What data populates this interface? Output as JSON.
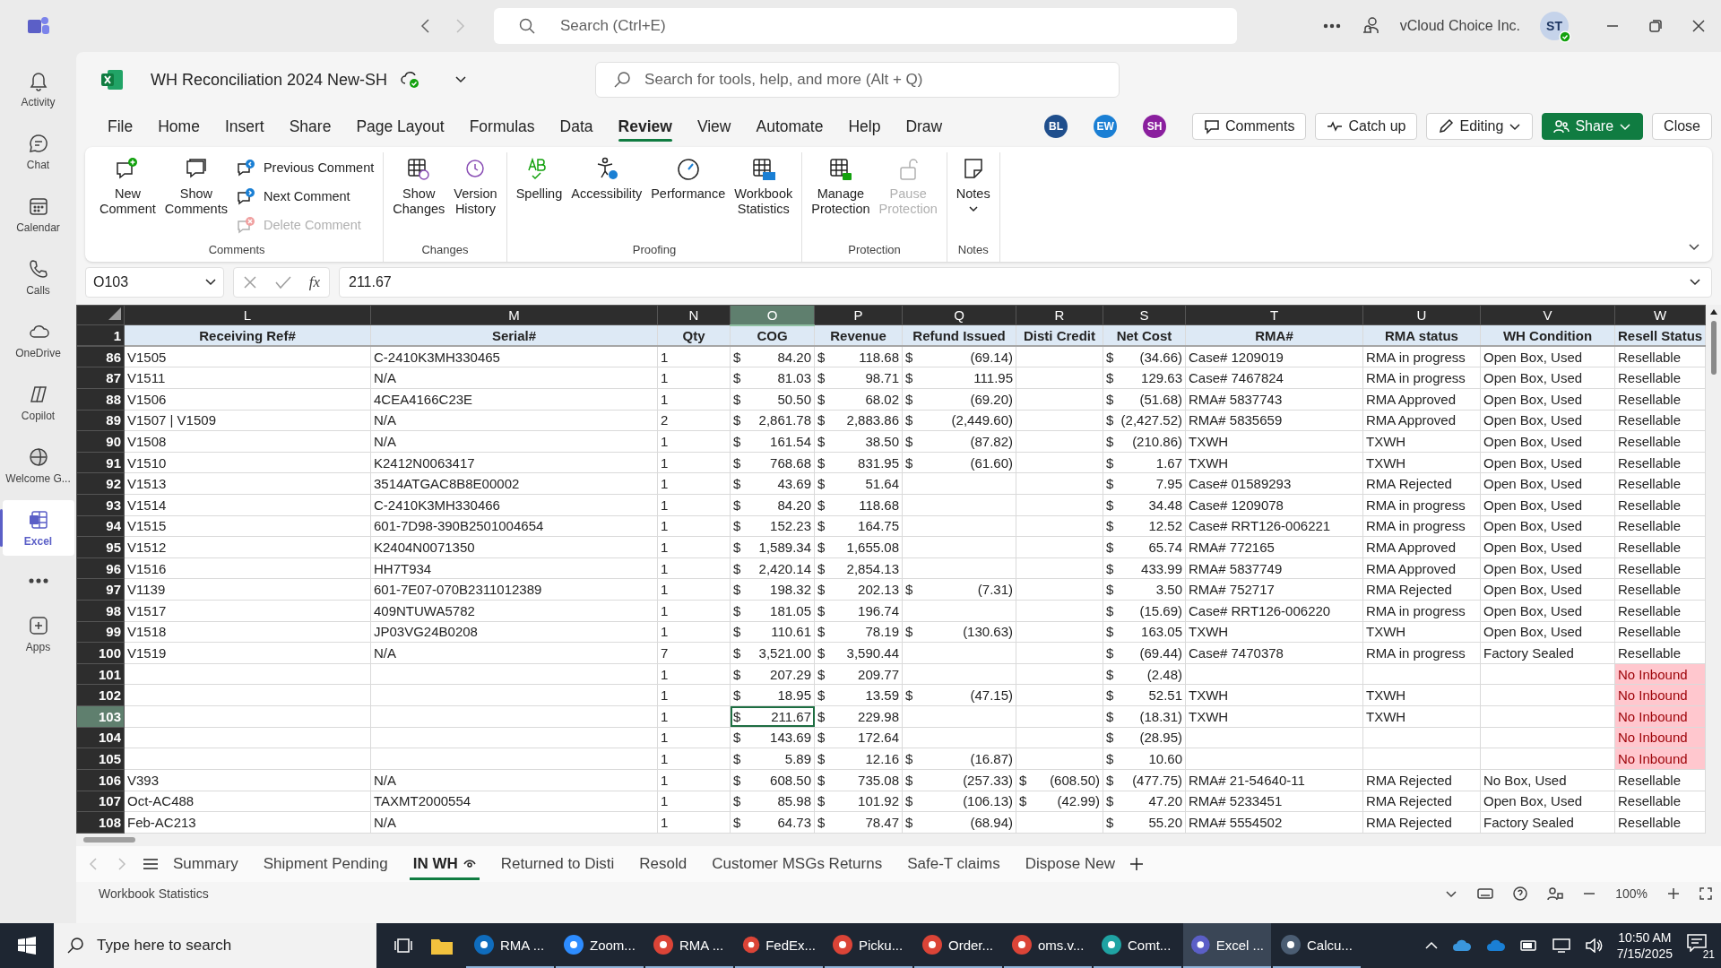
{
  "top_bar": {
    "search": {
      "placeholder": "Search (Ctrl+E)"
    },
    "org": "vCloud Choice Inc.",
    "avatar": "ST"
  },
  "rail": [
    {
      "kind": "app",
      "label": "Activity",
      "selected": false
    },
    {
      "kind": "app",
      "label": "Chat",
      "selected": false
    },
    {
      "kind": "app",
      "label": "Calendar",
      "selected": false
    },
    {
      "kind": "app",
      "label": "Calls",
      "selected": false
    },
    {
      "kind": "app",
      "label": "OneDrive",
      "selected": false
    },
    {
      "kind": "app",
      "label": "Copilot",
      "selected": false
    },
    {
      "kind": "app",
      "label": "Welcome G...",
      "selected": false
    },
    {
      "kind": "app",
      "label": "Excel",
      "selected": true
    },
    {
      "kind": "more"
    },
    {
      "kind": "app",
      "label": "Apps",
      "selected": false
    }
  ],
  "workbook": {
    "title": "WH Reconciliation 2024 New-SH",
    "search": {
      "placeholder": "Search for tools, help, and more (Alt + Q)"
    }
  },
  "menu_tabs": [
    {
      "label": "File",
      "selected": false
    },
    {
      "label": "Home",
      "selected": false
    },
    {
      "label": "Insert",
      "selected": false
    },
    {
      "label": "Share",
      "selected": false
    },
    {
      "label": "Page Layout",
      "selected": false
    },
    {
      "label": "Formulas",
      "selected": false
    },
    {
      "label": "Data",
      "selected": false
    },
    {
      "label": "Review",
      "selected": true
    },
    {
      "label": "View",
      "selected": false
    },
    {
      "label": "Automate",
      "selected": false
    },
    {
      "label": "Help",
      "selected": false
    },
    {
      "label": "Draw",
      "selected": false
    }
  ],
  "collaborators": [
    {
      "initials": "BL",
      "color": "#1f4e8c"
    },
    {
      "initials": "EW",
      "color": "#1a7fd4"
    },
    {
      "initials": "SH",
      "color": "#8a1f9e"
    }
  ],
  "actions": [
    {
      "label": "Comments",
      "kind": "comments"
    },
    {
      "label": "Catch up",
      "kind": "catchup"
    },
    {
      "label": "Editing",
      "kind": "editing"
    },
    {
      "label": "Share",
      "kind": "share"
    },
    {
      "label": "Close",
      "kind": "close"
    }
  ],
  "ribbon": [
    {
      "label": "Comments",
      "items": [
        {
          "kind": "large",
          "label": "New Comment",
          "disabled": false
        },
        {
          "kind": "large",
          "label": "Show Comments",
          "disabled": false
        },
        {
          "kind": "small",
          "label": "Previous Comment",
          "disabled": false
        },
        {
          "kind": "small",
          "label": "Next Comment",
          "disabled": false
        },
        {
          "kind": "small",
          "label": "Delete Comment",
          "disabled": true
        }
      ]
    },
    {
      "label": "Changes",
      "items": [
        {
          "kind": "large",
          "label": "Show Changes",
          "disabled": false
        },
        {
          "kind": "large",
          "label": "Version History",
          "disabled": false
        }
      ]
    },
    {
      "label": "Proofing",
      "items": [
        {
          "kind": "large",
          "label": "Spelling",
          "disabled": false
        },
        {
          "kind": "large",
          "label": "Accessibility",
          "disabled": false
        },
        {
          "kind": "large",
          "label": "Performance",
          "disabled": false
        },
        {
          "kind": "large",
          "label": "Workbook Statistics",
          "disabled": false
        }
      ]
    },
    {
      "label": "Protection",
      "items": [
        {
          "kind": "large",
          "label": "Manage Protection",
          "disabled": false
        },
        {
          "kind": "large",
          "label": "Pause Protection",
          "disabled": true
        }
      ]
    },
    {
      "label": "Notes",
      "items": [
        {
          "kind": "large",
          "label": "Notes",
          "disabled": false
        }
      ]
    }
  ],
  "formula_bar": {
    "name_box": "O103",
    "function_label": "fx",
    "value": "211.67"
  },
  "sheet": {
    "header_row": "1",
    "columns": [
      {
        "letter": "L",
        "header": "Receiving Ref#",
        "kind": "text",
        "selected": false
      },
      {
        "letter": "M",
        "header": "Serial#",
        "kind": "text",
        "selected": false
      },
      {
        "letter": "N",
        "header": "Qty",
        "kind": "text",
        "selected": false
      },
      {
        "letter": "O",
        "header": "COG",
        "kind": "currency",
        "selected": true
      },
      {
        "letter": "P",
        "header": "Revenue",
        "kind": "currency",
        "selected": false
      },
      {
        "letter": "Q",
        "header": "Refund Issued",
        "kind": "currency",
        "selected": false
      },
      {
        "letter": "R",
        "header": "Disti Credit",
        "kind": "currency",
        "selected": false
      },
      {
        "letter": "S",
        "header": "Net Cost",
        "kind": "currency",
        "selected": false
      },
      {
        "letter": "T",
        "header": "RMA#",
        "kind": "text",
        "selected": false
      },
      {
        "letter": "U",
        "header": "RMA status",
        "kind": "text",
        "selected": false
      },
      {
        "letter": "V",
        "header": "WH Condition",
        "kind": "text",
        "selected": false
      },
      {
        "letter": "W",
        "header": "Resell Status",
        "kind": "status",
        "selected": false
      }
    ],
    "rows": [
      {
        "number": "86",
        "selected": false,
        "cells": [
          "V1505",
          "C-2410K3MH330465",
          "1",
          [
            "$",
            "84.20"
          ],
          [
            "$",
            "118.68"
          ],
          [
            "$",
            "(69.14)"
          ],
          null,
          [
            "$",
            "(34.66)"
          ],
          "Case# 1209019",
          "RMA in progress",
          "Open Box, Used",
          {
            "text": "Resellable",
            "flagged": false
          }
        ]
      },
      {
        "number": "87",
        "selected": false,
        "cells": [
          "V1511",
          "N/A",
          "1",
          [
            "$",
            "81.03"
          ],
          [
            "$",
            "98.71"
          ],
          [
            "$",
            "111.95"
          ],
          null,
          [
            "$",
            "129.63"
          ],
          "Case# 7467824",
          "RMA in progress",
          "Open Box, Used",
          {
            "text": "Resellable",
            "flagged": false
          }
        ]
      },
      {
        "number": "88",
        "selected": false,
        "cells": [
          "V1506",
          "4CEA4166C23E",
          "1",
          [
            "$",
            "50.50"
          ],
          [
            "$",
            "68.02"
          ],
          [
            "$",
            "(69.20)"
          ],
          null,
          [
            "$",
            "(51.68)"
          ],
          "RMA# 5837743",
          "RMA Approved",
          "Open Box, Used",
          {
            "text": "Resellable",
            "flagged": false
          }
        ]
      },
      {
        "number": "89",
        "selected": false,
        "cells": [
          "V1507 | V1509",
          "N/A",
          "2",
          [
            "$",
            "2,861.78"
          ],
          [
            "$",
            "2,883.86"
          ],
          [
            "$",
            "(2,449.60)"
          ],
          null,
          [
            "$",
            "(2,427.52)"
          ],
          "RMA# 5835659",
          "RMA Approved",
          "Open Box, Used",
          {
            "text": "Resellable",
            "flagged": false
          }
        ]
      },
      {
        "number": "90",
        "selected": false,
        "cells": [
          "V1508",
          "N/A",
          "1",
          [
            "$",
            "161.54"
          ],
          [
            "$",
            "38.50"
          ],
          [
            "$",
            "(87.82)"
          ],
          null,
          [
            "$",
            "(210.86)"
          ],
          "TXWH",
          "TXWH",
          "Open Box, Used",
          {
            "text": "Resellable",
            "flagged": false
          }
        ]
      },
      {
        "number": "91",
        "selected": false,
        "cells": [
          "V1510",
          "K2412N0063417",
          "1",
          [
            "$",
            "768.68"
          ],
          [
            "$",
            "831.95"
          ],
          [
            "$",
            "(61.60)"
          ],
          null,
          [
            "$",
            "1.67"
          ],
          "TXWH",
          "TXWH",
          "Open Box, Used",
          {
            "text": "Resellable",
            "flagged": false
          }
        ]
      },
      {
        "number": "92",
        "selected": false,
        "cells": [
          "V1513",
          "3514ATGAC8B8E00002",
          "1",
          [
            "$",
            "43.69"
          ],
          [
            "$",
            "51.64"
          ],
          null,
          null,
          [
            "$",
            "7.95"
          ],
          "Case# 01589293",
          "RMA Rejected",
          "Open Box, Used",
          {
            "text": "Resellable",
            "flagged": false
          }
        ]
      },
      {
        "number": "93",
        "selected": false,
        "cells": [
          "V1514",
          "C-2410K3MH330466",
          "1",
          [
            "$",
            "84.20"
          ],
          [
            "$",
            "118.68"
          ],
          null,
          null,
          [
            "$",
            "34.48"
          ],
          "Case# 1209078",
          "RMA in progress",
          "Open Box, Used",
          {
            "text": "Resellable",
            "flagged": false
          }
        ]
      },
      {
        "number": "94",
        "selected": false,
        "cells": [
          "V1515",
          "601-7D98-390B2501004654",
          "1",
          [
            "$",
            "152.23"
          ],
          [
            "$",
            "164.75"
          ],
          null,
          null,
          [
            "$",
            "12.52"
          ],
          "Case# RRT126-006221",
          "RMA in progress",
          "Open Box, Used",
          {
            "text": "Resellable",
            "flagged": false
          }
        ]
      },
      {
        "number": "95",
        "selected": false,
        "cells": [
          "V1512",
          "K2404N0071350",
          "1",
          [
            "$",
            "1,589.34"
          ],
          [
            "$",
            "1,655.08"
          ],
          null,
          null,
          [
            "$",
            "65.74"
          ],
          "RMA# 772165",
          "RMA Approved",
          "Open Box, Used",
          {
            "text": "Resellable",
            "flagged": false
          }
        ]
      },
      {
        "number": "96",
        "selected": false,
        "cells": [
          "V1516",
          "HH7T934",
          "1",
          [
            "$",
            "2,420.14"
          ],
          [
            "$",
            "2,854.13"
          ],
          null,
          null,
          [
            "$",
            "433.99"
          ],
          "RMA# 5837749",
          "RMA Approved",
          "Open Box, Used",
          {
            "text": "Resellable",
            "flagged": false
          }
        ]
      },
      {
        "number": "97",
        "selected": false,
        "cells": [
          "V1139",
          "601-7E07-070B2311012389",
          "1",
          [
            "$",
            "198.32"
          ],
          [
            "$",
            "202.13"
          ],
          [
            "$",
            "(7.31)"
          ],
          null,
          [
            "$",
            "3.50"
          ],
          "RMA# 752717",
          "RMA Rejected",
          "Open Box, Used",
          {
            "text": "Resellable",
            "flagged": false
          }
        ]
      },
      {
        "number": "98",
        "selected": false,
        "cells": [
          "V1517",
          "409NTUWA5782",
          "1",
          [
            "$",
            "181.05"
          ],
          [
            "$",
            "196.74"
          ],
          null,
          null,
          [
            "$",
            "(15.69)"
          ],
          "Case# RRT126-006220",
          "RMA in progress",
          "Open Box, Used",
          {
            "text": "Resellable",
            "flagged": false
          }
        ]
      },
      {
        "number": "99",
        "selected": false,
        "cells": [
          "V1518",
          "JP03VG24B0208",
          "1",
          [
            "$",
            "110.61"
          ],
          [
            "$",
            "78.19"
          ],
          [
            "$",
            "(130.63)"
          ],
          null,
          [
            "$",
            "163.05"
          ],
          "TXWH",
          "TXWH",
          "Open Box, Used",
          {
            "text": "Resellable",
            "flagged": false
          }
        ]
      },
      {
        "number": "100",
        "selected": false,
        "cells": [
          "V1519",
          "N/A",
          "7",
          [
            "$",
            "3,521.00"
          ],
          [
            "$",
            "3,590.44"
          ],
          null,
          null,
          [
            "$",
            "(69.44)"
          ],
          "Case# 7470378",
          "RMA in progress",
          "Factory Sealed",
          {
            "text": "Resellable",
            "flagged": false
          }
        ]
      },
      {
        "number": "101",
        "selected": false,
        "cells": [
          null,
          null,
          "1",
          [
            "$",
            "207.29"
          ],
          [
            "$",
            "209.77"
          ],
          null,
          null,
          [
            "$",
            "(2.48)"
          ],
          null,
          null,
          null,
          {
            "text": "No Inbound",
            "flagged": true
          }
        ]
      },
      {
        "number": "102",
        "selected": false,
        "cells": [
          null,
          null,
          "1",
          [
            "$",
            "18.95"
          ],
          [
            "$",
            "13.59"
          ],
          [
            "$",
            "(47.15)"
          ],
          null,
          [
            "$",
            "52.51"
          ],
          "TXWH",
          "TXWH",
          null,
          {
            "text": "No Inbound",
            "flagged": true
          }
        ]
      },
      {
        "number": "103",
        "selected": true,
        "cells": [
          null,
          null,
          "1",
          [
            "$",
            "211.67"
          ],
          [
            "$",
            "229.98"
          ],
          null,
          null,
          [
            "$",
            "(18.31)"
          ],
          "TXWH",
          "TXWH",
          null,
          {
            "text": "No Inbound",
            "flagged": true
          }
        ]
      },
      {
        "number": "104",
        "selected": false,
        "cells": [
          null,
          null,
          "1",
          [
            "$",
            "143.69"
          ],
          [
            "$",
            "172.64"
          ],
          null,
          null,
          [
            "$",
            "(28.95)"
          ],
          null,
          null,
          null,
          {
            "text": "No Inbound",
            "flagged": true
          }
        ]
      },
      {
        "number": "105",
        "selected": false,
        "cells": [
          null,
          null,
          "1",
          [
            "$",
            "5.89"
          ],
          [
            "$",
            "12.16"
          ],
          [
            "$",
            "(16.87)"
          ],
          null,
          [
            "$",
            "10.60"
          ],
          null,
          null,
          null,
          {
            "text": "No Inbound",
            "flagged": true
          }
        ]
      },
      {
        "number": "106",
        "selected": false,
        "cells": [
          "V393",
          "N/A",
          "1",
          [
            "$",
            "608.50"
          ],
          [
            "$",
            "735.08"
          ],
          [
            "$",
            "(257.33)"
          ],
          [
            "$",
            "(608.50)"
          ],
          [
            "$",
            "(477.75)"
          ],
          "RMA# 21-54640-11",
          "RMA Rejected",
          "No Box, Used",
          {
            "text": "Resellable",
            "flagged": false
          }
        ]
      },
      {
        "number": "107",
        "selected": false,
        "cells": [
          "Oct-AC488",
          "TAXMT2000554",
          "1",
          [
            "$",
            "85.98"
          ],
          [
            "$",
            "101.92"
          ],
          [
            "$",
            "(106.13)"
          ],
          [
            "$",
            "(42.99)"
          ],
          [
            "$",
            "47.20"
          ],
          "RMA# 5233451",
          "RMA Rejected",
          "Open Box, Used",
          {
            "text": "Resellable",
            "flagged": false
          }
        ]
      },
      {
        "number": "108",
        "selected": false,
        "cells": [
          "Feb-AC213",
          "N/A",
          "1",
          [
            "$",
            "64.73"
          ],
          [
            "$",
            "78.47"
          ],
          [
            "$",
            "(68.94)"
          ],
          null,
          [
            "$",
            "55.20"
          ],
          "RMA# 5554502",
          "RMA Rejected",
          "Factory Sealed",
          {
            "text": "Resellable",
            "flagged": false
          }
        ]
      }
    ]
  },
  "sheet_tabs": [
    {
      "label": "Summary",
      "selected": false
    },
    {
      "label": "Shipment Pending",
      "selected": false
    },
    {
      "label": "IN WH",
      "selected": true
    },
    {
      "label": "Returned to Disti",
      "selected": false
    },
    {
      "label": "Resold",
      "selected": false
    },
    {
      "label": "Customer MSGs Returns",
      "selected": false
    },
    {
      "label": "Safe-T claims",
      "selected": false
    },
    {
      "label": "Dispose New",
      "selected": false
    }
  ],
  "status_bar": {
    "text": "Workbook Statistics",
    "zoom": "100%"
  },
  "taskbar": {
    "search": {
      "placeholder": "Type here to search"
    },
    "apps": [
      {
        "label": "RMA ...",
        "selected": false
      },
      {
        "label": "Zoom...",
        "selected": false
      },
      {
        "label": "RMA ...",
        "selected": false
      },
      {
        "label": "FedEx...",
        "selected": false
      },
      {
        "label": "Picku...",
        "selected": false
      },
      {
        "label": "Order...",
        "selected": false
      },
      {
        "label": "oms.v...",
        "selected": false
      },
      {
        "label": "Comt...",
        "selected": false
      },
      {
        "label": "Excel ...",
        "selected": true
      },
      {
        "label": "Calcu...",
        "selected": false
      }
    ],
    "time": "10:50 AM",
    "date": "7/15/2025",
    "notifications": "21"
  }
}
